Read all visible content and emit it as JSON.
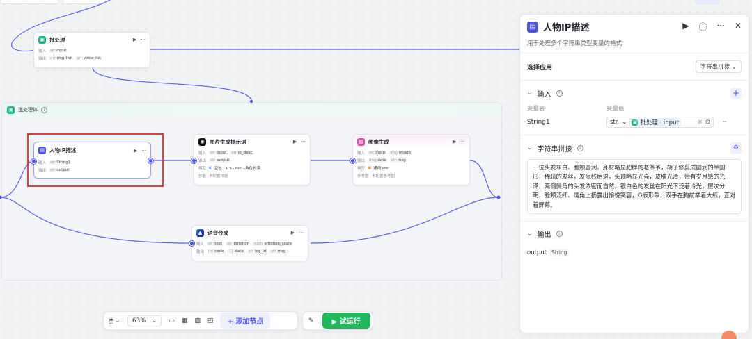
{
  "batch_node": {
    "title": "批处理",
    "input_label": "输入",
    "output_label": "输出",
    "inputs": [
      "input"
    ],
    "outputs": [
      "img_list",
      "voice_list"
    ]
  },
  "batch_body": {
    "title": "批处理体"
  },
  "nodes": {
    "ip_desc": {
      "title": "人物IP描述",
      "input_label": "输入",
      "output_label": "输出",
      "inputs": [
        "String1"
      ],
      "outputs": [
        "output"
      ]
    },
    "image_prompt": {
      "title": "图片生成提示词",
      "input_label": "输入",
      "output_label": "输出",
      "model_label": "模型",
      "skill_label": "技能",
      "inputs": [
        "input",
        "ip_desc"
      ],
      "outputs": [
        "output"
      ],
      "model": "豆包 · 1.5 · Pro · 角色扮演",
      "skill": "未配置技能"
    },
    "image_gen": {
      "title": "图像生成",
      "input_label": "输入",
      "output_label": "输出",
      "model_label": "模型",
      "ref_label": "参考图",
      "inputs": [
        "input",
        "image"
      ],
      "outputs": [
        "data",
        "msg"
      ],
      "model": "通用 Pro",
      "ref": "未配置参考图"
    },
    "tts": {
      "title": "语音合成",
      "input_label": "输入",
      "output_label": "输出",
      "inputs": [
        "text",
        "emotion",
        "emotion_scale"
      ],
      "outputs": [
        "code",
        "data",
        "log_id",
        "msg"
      ]
    }
  },
  "toolbar": {
    "zoom": "63%",
    "add_node": "添加节点",
    "run": "试运行"
  },
  "panel": {
    "title": "人物IP描述",
    "subtitle": "用于处理多个字符串类型变量的格式",
    "select_app_label": "选择应用",
    "select_app_value": "字符串拼接",
    "input_section": "输入",
    "col_name": "变量名",
    "col_value": "变量值",
    "var_name": "String1",
    "var_type": "str.",
    "var_ref": "批处理 · input",
    "concat_section": "字符串拼接",
    "concat_text": "一位头发灰白、脸颊圆润、身材略显肥胖的老爷爷，胡子修剪成圆润的半圆形，稀疏的发丝，发际线后退，头顶略显光亮，皮肤光滑，带有岁月感的光泽，两侧鬓角的头发浓密而自然，银白色的发丝在阳光下泛着冷光，层次分明，脸颊泛红、嘴角上扬露出愉悦笑容，Q版形象，双手在胸前举着大纸，正对着屏幕。",
    "output_section": "输出",
    "output_name": "output",
    "output_type": "String"
  },
  "colors": {
    "accent": "#4d53e8",
    "run": "#20b85a",
    "selection": "#e54040"
  }
}
